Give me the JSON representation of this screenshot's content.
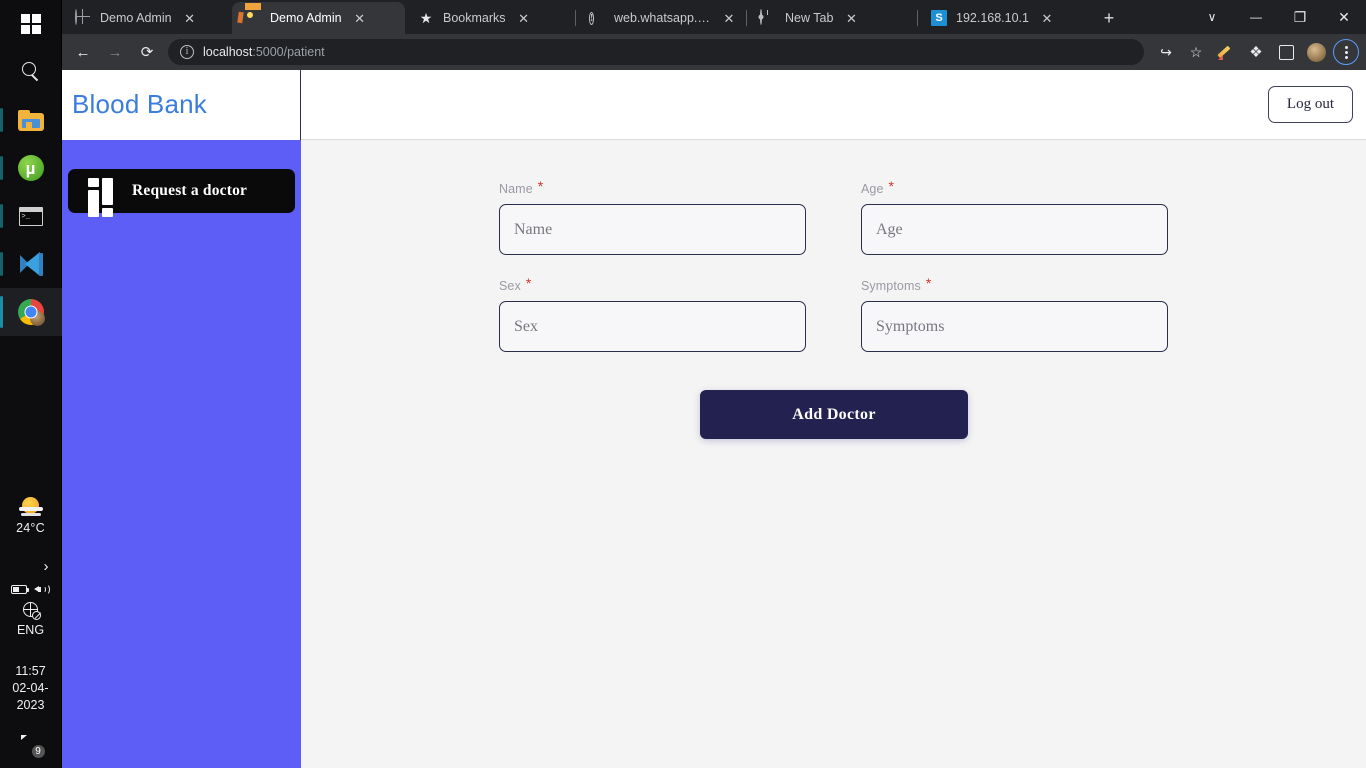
{
  "taskbar": {
    "icons": [
      {
        "name": "windows-start-icon",
        "label": "Start"
      },
      {
        "name": "search-icon",
        "label": "Search"
      },
      {
        "name": "file-explorer-icon",
        "label": "File Explorer"
      },
      {
        "name": "utorrent-icon",
        "label": "uTorrent"
      },
      {
        "name": "command-prompt-icon",
        "label": "Command Prompt"
      },
      {
        "name": "vscode-icon",
        "label": "Visual Studio Code"
      },
      {
        "name": "chrome-icon",
        "label": "Google Chrome"
      }
    ],
    "tray": {
      "temperature": "24°C",
      "chevron": "›",
      "language": "ENG",
      "time": "11:57",
      "date": "02-04-2023",
      "notification_count": "9",
      "utorrent_glyph": "µ"
    }
  },
  "browser": {
    "tabs": [
      {
        "title": "Demo Admin",
        "favicon": "globe-icon",
        "active": false,
        "close": "✕"
      },
      {
        "title": "Demo Admin",
        "favicon": "beach-icon",
        "active": true,
        "close": "✕"
      },
      {
        "title": "Bookmarks",
        "favicon": "star-icon",
        "active": false,
        "close": "✕"
      },
      {
        "title": "web.whatsapp.com",
        "favicon": "info-icon",
        "active": false,
        "close": "✕"
      },
      {
        "title": "New Tab",
        "favicon": "chrome-icon",
        "active": false,
        "close": "✕"
      },
      {
        "title": "192.168.10.1",
        "favicon": "s-icon",
        "active": false,
        "close": "✕"
      }
    ],
    "new_tab_label": "+",
    "window_controls": {
      "chevron_down": "∨",
      "minimize": "—",
      "maximize": "❐",
      "close": "✕"
    },
    "nav": {
      "back": "←",
      "forward": "→",
      "reload": "⟳"
    },
    "omnibox": {
      "info_glyph": "i",
      "url_bold": "localhost",
      "url_rest": ":5000/patient",
      "full_url": "localhost:5000/patient"
    },
    "toolbar_right": {
      "share": "↪",
      "bookmark": "☆",
      "pen": "pen-icon",
      "extensions": "❖",
      "side_panel": "side-panel-icon",
      "profile": "avatar-icon",
      "menu": "three-dot-menu-icon"
    }
  },
  "app": {
    "brand": "Blood Bank",
    "logout_label": "Log out",
    "sidebar": {
      "items": [
        {
          "label": "Request a doctor",
          "icon": "dashboard-grid-icon"
        }
      ]
    },
    "form": {
      "rows": [
        [
          {
            "label": "Name",
            "required": "*",
            "placeholder": "Name",
            "value": "",
            "name": "name-field"
          },
          {
            "label": "Age",
            "required": "*",
            "placeholder": "Age",
            "value": "",
            "name": "age-field"
          }
        ],
        [
          {
            "label": "Sex",
            "required": "*",
            "placeholder": "Sex",
            "value": "",
            "name": "sex-field"
          },
          {
            "label": "Symptoms",
            "required": "*",
            "placeholder": "Symptoms",
            "value": "",
            "name": "symptoms-field"
          }
        ]
      ],
      "submit_label": "Add Doctor"
    }
  },
  "colors": {
    "sidebar_bg": "#5d5ef5",
    "brand_blue": "#3b7ddd",
    "nav_item_bg": "#0a0a0a",
    "submit_bg": "#232150",
    "input_border": "#2b2f4c",
    "required_red": "#d0342c",
    "page_bg": "#f4f4f4"
  }
}
